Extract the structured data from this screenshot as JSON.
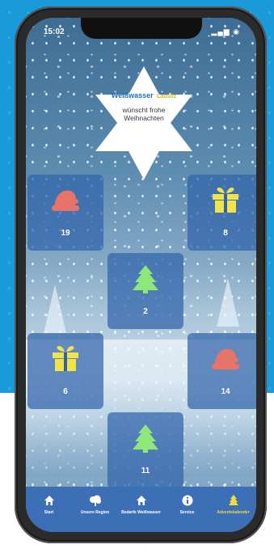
{
  "status": {
    "time": "15:02",
    "icons": "▂▄▆ ◉"
  },
  "banner": {
    "logo_main": "Weißwasser",
    "logo_sub": "Lausitz",
    "greeting_line1": "wünscht frohe",
    "greeting_line2": "Weihnachten"
  },
  "doors": [
    {
      "number": "19",
      "icon": "santa-hat-icon"
    },
    {
      "number": "8",
      "icon": "gift-icon"
    },
    {
      "number": "2",
      "icon": "tree-icon"
    },
    {
      "number": "6",
      "icon": "gift-icon"
    },
    {
      "number": "14",
      "icon": "santa-hat-icon"
    },
    {
      "number": "11",
      "icon": "tree-icon"
    }
  ],
  "nav": [
    {
      "label": "Start",
      "icon": "home-icon",
      "active": false
    },
    {
      "label": "Unsere Region",
      "icon": "tree-cloud-icon",
      "active": false
    },
    {
      "label": "Bedarfe Weißwasser",
      "icon": "home-icon",
      "active": false
    },
    {
      "label": "Service",
      "icon": "info-icon",
      "active": false
    },
    {
      "label": "Adventskalender",
      "icon": "tree-icon",
      "active": true
    }
  ],
  "colors": {
    "background_blue": "#1a9ad8",
    "tile": "#3064aa",
    "nav": "#3c6fb5",
    "hat": "#e77468",
    "gift": "#f1e34b",
    "tree": "#8fe67a",
    "active": "#f4dc3a"
  }
}
